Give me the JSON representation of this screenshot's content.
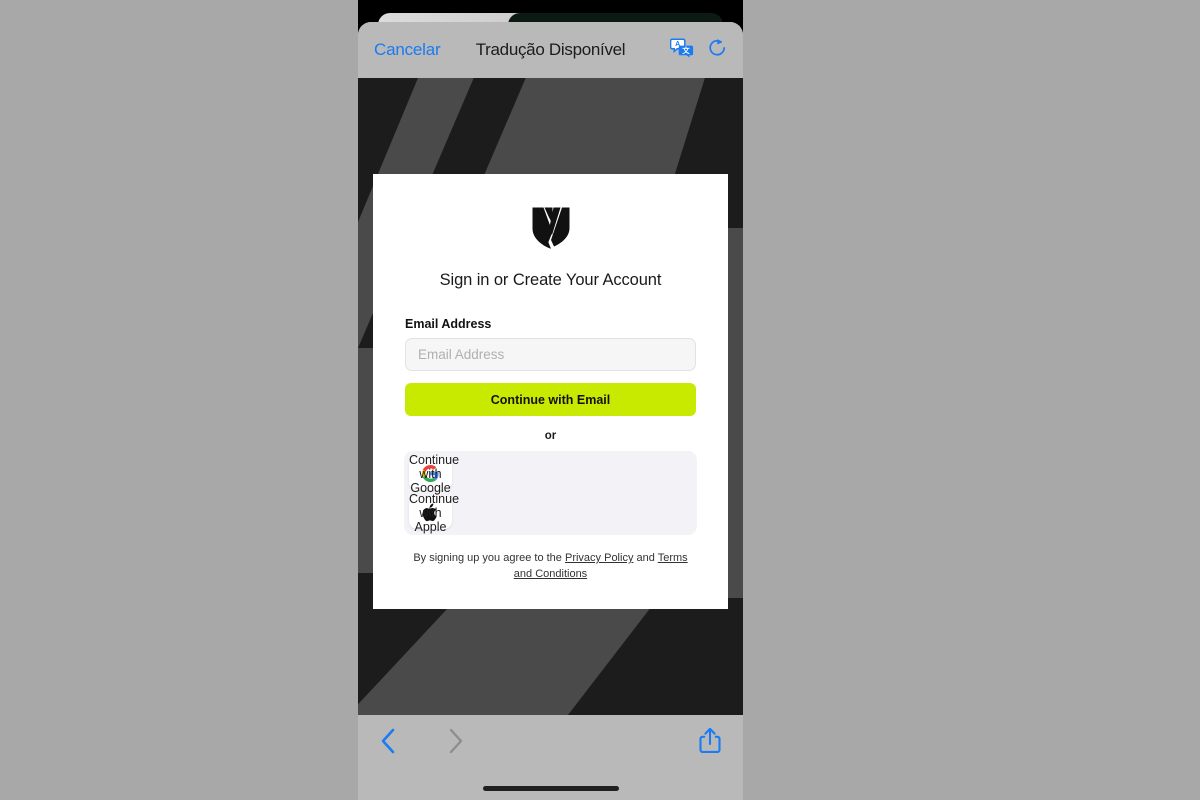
{
  "toolbar": {
    "cancel_label": "Cancelar",
    "title": "Tradução Disponível",
    "translate_icon": "translate-icon",
    "reload_icon": "reload-icon"
  },
  "page": {
    "brand_logo_icon": "shield-chevron-logo",
    "heading": "Sign in or Create Your Account",
    "email_label": "Email Address",
    "email_value": "",
    "email_placeholder": "Email Address",
    "continue_email_label": "Continue with Email",
    "or_label": "or",
    "social_buttons": [
      {
        "label": "Continue with Google",
        "icon": "google-icon"
      },
      {
        "label": "Continue with Apple",
        "icon": "apple-icon"
      }
    ],
    "legal": {
      "prefix": "By signing up you agree to the ",
      "privacy_policy": "Privacy Policy",
      "conjunction": " and ",
      "terms": "Terms and Conditions"
    }
  },
  "bottom_bar": {
    "back_icon": "chevron-left-icon",
    "forward_icon": "chevron-right-icon",
    "share_icon": "share-icon"
  },
  "colors": {
    "accent_blue": "#1a7bf2",
    "cta_lime": "#c8ea00",
    "disabled_gray": "#8e8e8e",
    "sheet_gray": "#b9b9b9",
    "page_dark": "#4a4a4a",
    "page_stripe": "#1c1c1c",
    "canvas": "#a8a8a8"
  }
}
